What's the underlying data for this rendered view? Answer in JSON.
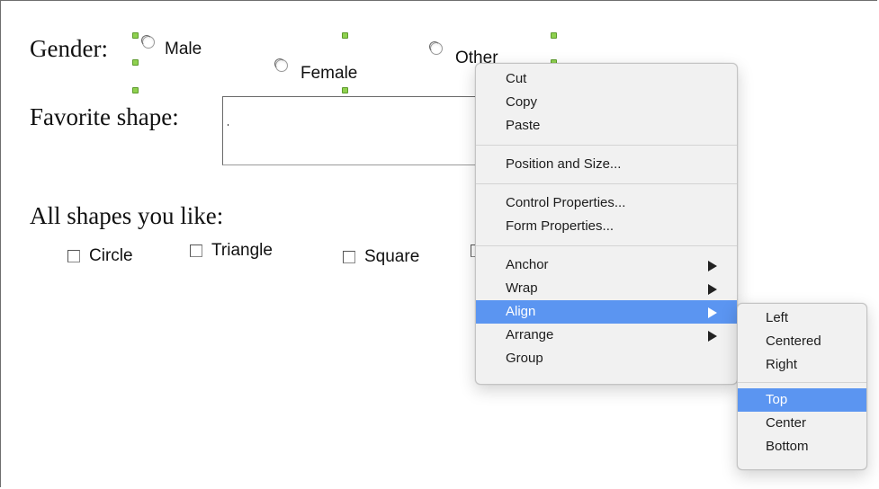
{
  "form": {
    "gender_label": "Gender:",
    "gender_options": [
      "Male",
      "Female",
      "Other"
    ],
    "favorite_shape_label": "Favorite shape:",
    "favorite_shape_value": "",
    "all_shapes_label": "All shapes you like:",
    "shape_options": [
      "Circle",
      "Triangle",
      "Square"
    ]
  },
  "context_menu": {
    "items": [
      {
        "label": "Cut"
      },
      {
        "label": "Copy"
      },
      {
        "label": "Paste"
      },
      {
        "label": "Position and Size..."
      },
      {
        "label": "Control Properties..."
      },
      {
        "label": "Form Properties..."
      },
      {
        "label": "Anchor",
        "submenu": true
      },
      {
        "label": "Wrap",
        "submenu": true
      },
      {
        "label": "Align",
        "submenu": true,
        "highlighted": true
      },
      {
        "label": "Arrange",
        "submenu": true
      },
      {
        "label": "Group"
      }
    ]
  },
  "align_submenu": {
    "items": [
      {
        "label": "Left"
      },
      {
        "label": "Centered"
      },
      {
        "label": "Right"
      },
      {
        "label": "Top",
        "highlighted": true
      },
      {
        "label": "Center"
      },
      {
        "label": "Bottom"
      }
    ]
  },
  "colors": {
    "highlight": "#5b95f1",
    "menu_background": "#f1f1f1",
    "selection_handle": "#8fd14f"
  }
}
